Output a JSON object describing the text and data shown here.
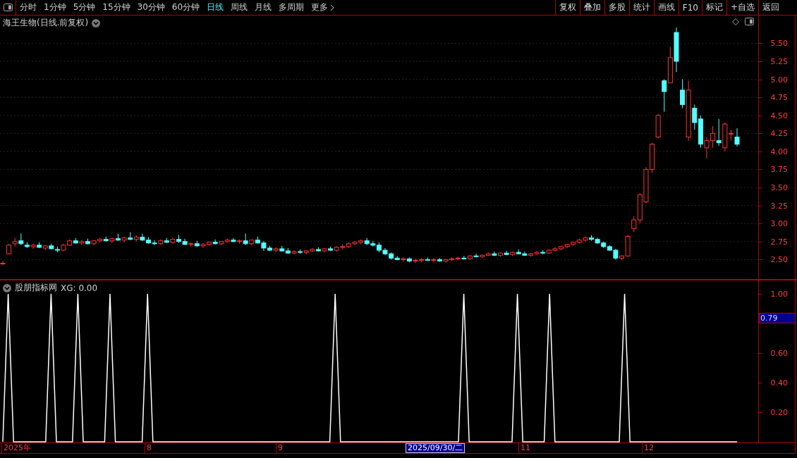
{
  "toolbar": {
    "periods": [
      {
        "label": "分时",
        "selected": false
      },
      {
        "label": "1分钟",
        "selected": false
      },
      {
        "label": "5分钟",
        "selected": false
      },
      {
        "label": "15分钟",
        "selected": false
      },
      {
        "label": "30分钟",
        "selected": false
      },
      {
        "label": "60分钟",
        "selected": false
      },
      {
        "label": "日线",
        "selected": true
      },
      {
        "label": "周线",
        "selected": false
      },
      {
        "label": "月线",
        "selected": false
      },
      {
        "label": "多周期",
        "selected": false
      },
      {
        "label": "更多",
        "selected": false
      }
    ],
    "actions": [
      "复权",
      "叠加",
      "多股",
      "统计",
      "画线",
      "F10",
      "标记",
      "+自选",
      "返回"
    ]
  },
  "price_panel": {
    "title": "海王生物(日线.前复权)",
    "chart_data": {
      "type": "candlestick",
      "grid": true,
      "ylim": [
        2.23,
        6.1
      ],
      "yticks": [
        {
          "value": 5.5,
          "label": "5.50"
        },
        {
          "value": 5.25,
          "label": "5.25"
        },
        {
          "value": 5,
          "label": "5.00"
        },
        {
          "value": 4.75,
          "label": "4.75"
        },
        {
          "value": 4.5,
          "label": "4.50"
        },
        {
          "value": 4.25,
          "label": "4.25"
        },
        {
          "value": 4,
          "label": "4.00"
        },
        {
          "value": 3.75,
          "label": "3.75"
        },
        {
          "value": 3.5,
          "label": "3.50"
        },
        {
          "value": 3.25,
          "label": "3.25"
        },
        {
          "value": 3,
          "label": "3.00"
        },
        {
          "value": 2.75,
          "label": "2.75"
        },
        {
          "value": 2.5,
          "label": "2.50"
        }
      ],
      "ohlc": [
        [
          2.44,
          2.48,
          2.42,
          2.45
        ],
        [
          2.58,
          2.72,
          2.57,
          2.7
        ],
        [
          2.72,
          2.8,
          2.68,
          2.75
        ],
        [
          2.76,
          2.86,
          2.7,
          2.72
        ],
        [
          2.7,
          2.74,
          2.66,
          2.68
        ],
        [
          2.68,
          2.72,
          2.65,
          2.7
        ],
        [
          2.7,
          2.74,
          2.66,
          2.67
        ],
        [
          2.66,
          2.7,
          2.63,
          2.69
        ],
        [
          2.69,
          2.72,
          2.64,
          2.65
        ],
        [
          2.64,
          2.68,
          2.6,
          2.63
        ],
        [
          2.63,
          2.72,
          2.62,
          2.7
        ],
        [
          2.7,
          2.78,
          2.69,
          2.76
        ],
        [
          2.76,
          2.8,
          2.72,
          2.73
        ],
        [
          2.73,
          2.77,
          2.7,
          2.75
        ],
        [
          2.75,
          2.79,
          2.71,
          2.72
        ],
        [
          2.72,
          2.77,
          2.7,
          2.76
        ],
        [
          2.76,
          2.8,
          2.74,
          2.78
        ],
        [
          2.78,
          2.82,
          2.75,
          2.76
        ],
        [
          2.76,
          2.8,
          2.73,
          2.79
        ],
        [
          2.79,
          2.86,
          2.76,
          2.77
        ],
        [
          2.77,
          2.82,
          2.74,
          2.8
        ],
        [
          2.8,
          2.88,
          2.77,
          2.78
        ],
        [
          2.78,
          2.84,
          2.75,
          2.81
        ],
        [
          2.81,
          2.86,
          2.76,
          2.77
        ],
        [
          2.77,
          2.81,
          2.72,
          2.73
        ],
        [
          2.73,
          2.77,
          2.7,
          2.72
        ],
        [
          2.72,
          2.78,
          2.7,
          2.76
        ],
        [
          2.76,
          2.8,
          2.73,
          2.74
        ],
        [
          2.74,
          2.8,
          2.72,
          2.78
        ],
        [
          2.78,
          2.84,
          2.73,
          2.75
        ],
        [
          2.75,
          2.79,
          2.7,
          2.71
        ],
        [
          2.71,
          2.74,
          2.68,
          2.72
        ],
        [
          2.72,
          2.76,
          2.68,
          2.69
        ],
        [
          2.69,
          2.73,
          2.66,
          2.71
        ],
        [
          2.71,
          2.75,
          2.69,
          2.74
        ],
        [
          2.74,
          2.78,
          2.71,
          2.72
        ],
        [
          2.72,
          2.76,
          2.7,
          2.75
        ],
        [
          2.75,
          2.79,
          2.73,
          2.77
        ],
        [
          2.77,
          2.8,
          2.74,
          2.75
        ],
        [
          2.75,
          2.78,
          2.72,
          2.76
        ],
        [
          2.76,
          2.86,
          2.7,
          2.72
        ],
        [
          2.72,
          2.78,
          2.7,
          2.77
        ],
        [
          2.77,
          2.82,
          2.72,
          2.73
        ],
        [
          2.73,
          2.76,
          2.62,
          2.66
        ],
        [
          2.66,
          2.69,
          2.62,
          2.63
        ],
        [
          2.63,
          2.67,
          2.6,
          2.65
        ],
        [
          2.65,
          2.69,
          2.61,
          2.62
        ],
        [
          2.62,
          2.66,
          2.58,
          2.59
        ],
        [
          2.59,
          2.63,
          2.57,
          2.61
        ],
        [
          2.61,
          2.64,
          2.58,
          2.6
        ],
        [
          2.6,
          2.63,
          2.57,
          2.62
        ],
        [
          2.62,
          2.66,
          2.6,
          2.64
        ],
        [
          2.64,
          2.67,
          2.61,
          2.62
        ],
        [
          2.62,
          2.66,
          2.6,
          2.65
        ],
        [
          2.65,
          2.68,
          2.62,
          2.63
        ],
        [
          2.63,
          2.69,
          2.61,
          2.67
        ],
        [
          2.67,
          2.71,
          2.64,
          2.68
        ],
        [
          2.68,
          2.74,
          2.66,
          2.72
        ],
        [
          2.72,
          2.76,
          2.7,
          2.74
        ],
        [
          2.74,
          2.78,
          2.71,
          2.76
        ],
        [
          2.76,
          2.8,
          2.7,
          2.72
        ],
        [
          2.72,
          2.76,
          2.68,
          2.7
        ],
        [
          2.7,
          2.74,
          2.6,
          2.63
        ],
        [
          2.63,
          2.66,
          2.56,
          2.58
        ],
        [
          2.58,
          2.6,
          2.5,
          2.52
        ],
        [
          2.52,
          2.55,
          2.49,
          2.5
        ],
        [
          2.5,
          2.53,
          2.47,
          2.51
        ],
        [
          2.51,
          2.53,
          2.46,
          2.48
        ],
        [
          2.48,
          2.51,
          2.45,
          2.49
        ],
        [
          2.49,
          2.52,
          2.46,
          2.5
        ],
        [
          2.5,
          2.53,
          2.48,
          2.49
        ],
        [
          2.49,
          2.52,
          2.46,
          2.5
        ],
        [
          2.5,
          2.52,
          2.47,
          2.48
        ],
        [
          2.48,
          2.51,
          2.46,
          2.5
        ],
        [
          2.5,
          2.53,
          2.48,
          2.51
        ],
        [
          2.51,
          2.54,
          2.49,
          2.52
        ],
        [
          2.52,
          2.55,
          2.5,
          2.51
        ],
        [
          2.51,
          2.56,
          2.5,
          2.55
        ],
        [
          2.55,
          2.58,
          2.53,
          2.54
        ],
        [
          2.54,
          2.57,
          2.52,
          2.56
        ],
        [
          2.56,
          2.6,
          2.55,
          2.58
        ],
        [
          2.58,
          2.61,
          2.55,
          2.56
        ],
        [
          2.56,
          2.6,
          2.54,
          2.59
        ],
        [
          2.59,
          2.62,
          2.56,
          2.57
        ],
        [
          2.57,
          2.61,
          2.55,
          2.6
        ],
        [
          2.6,
          2.64,
          2.58,
          2.58
        ],
        [
          2.58,
          2.61,
          2.55,
          2.56
        ],
        [
          2.56,
          2.59,
          2.54,
          2.58
        ],
        [
          2.58,
          2.62,
          2.56,
          2.6
        ],
        [
          2.6,
          2.63,
          2.57,
          2.59
        ],
        [
          2.59,
          2.64,
          2.58,
          2.63
        ],
        [
          2.63,
          2.67,
          2.61,
          2.65
        ],
        [
          2.65,
          2.69,
          2.63,
          2.68
        ],
        [
          2.68,
          2.72,
          2.66,
          2.71
        ],
        [
          2.71,
          2.75,
          2.69,
          2.74
        ],
        [
          2.74,
          2.79,
          2.72,
          2.77
        ],
        [
          2.77,
          2.82,
          2.75,
          2.8
        ],
        [
          2.8,
          2.84,
          2.76,
          2.78
        ],
        [
          2.78,
          2.8,
          2.72,
          2.73
        ],
        [
          2.73,
          2.75,
          2.66,
          2.68
        ],
        [
          2.68,
          2.7,
          2.62,
          2.63
        ],
        [
          2.63,
          2.65,
          2.5,
          2.52
        ],
        [
          2.52,
          2.56,
          2.49,
          2.55
        ],
        [
          2.55,
          2.85,
          2.54,
          2.82
        ],
        [
          2.93,
          3.1,
          2.88,
          3.05
        ],
        [
          3.05,
          3.42,
          3.0,
          3.4
        ],
        [
          3.3,
          3.78,
          3.28,
          3.75
        ],
        [
          3.75,
          4.12,
          3.7,
          4.1
        ],
        [
          4.2,
          4.52,
          4.18,
          4.5
        ],
        [
          4.98,
          5.0,
          4.55,
          4.83
        ],
        [
          4.95,
          5.45,
          4.95,
          5.3
        ],
        [
          5.65,
          5.72,
          5.1,
          5.25
        ],
        [
          4.85,
          5.0,
          4.6,
          4.65
        ],
        [
          4.2,
          4.98,
          4.15,
          4.85
        ],
        [
          4.6,
          4.65,
          4.3,
          4.4
        ],
        [
          4.45,
          4.5,
          4.05,
          4.1
        ],
        [
          4.05,
          4.2,
          3.9,
          4.15
        ],
        [
          4.15,
          4.35,
          4.05,
          4.25
        ],
        [
          4.15,
          4.45,
          4.08,
          4.12
        ],
        [
          4.05,
          4.4,
          4.0,
          4.38
        ],
        [
          4.25,
          4.3,
          4.15,
          4.25
        ],
        [
          4.2,
          4.32,
          4.07,
          4.1
        ]
      ]
    }
  },
  "indicator_panel": {
    "title": "股朋指标网",
    "reading": "XG: 0.00",
    "cursor_value": "0.79",
    "chart_data": {
      "type": "line",
      "ylim": [
        0,
        1.09
      ],
      "categories": [
        null,
        null,
        null,
        null,
        null,
        null,
        null,
        null,
        null,
        null,
        null,
        null,
        null,
        null,
        null,
        null,
        null,
        null,
        null,
        null,
        null,
        null,
        null,
        null,
        null,
        null,
        null,
        null,
        null,
        null,
        null,
        null,
        null,
        null,
        null,
        null,
        null,
        null,
        null,
        null,
        null,
        null,
        null,
        null,
        null,
        null,
        null,
        null,
        null,
        null,
        null,
        null,
        null,
        null,
        null,
        null,
        null,
        null,
        null,
        null,
        null,
        null,
        null,
        null,
        null,
        null,
        null,
        null,
        null,
        null,
        null,
        null,
        null,
        null,
        null,
        null,
        null,
        null,
        null,
        null,
        null,
        null,
        null,
        null,
        null,
        null,
        null,
        null,
        null,
        null,
        null,
        null,
        null,
        null,
        null,
        null,
        null,
        null,
        null,
        null,
        null,
        null,
        null,
        null,
        null,
        null,
        null,
        null,
        null,
        null,
        null,
        null,
        null,
        null,
        null,
        null,
        null,
        null,
        null,
        null,
        null,
        null,
        null,
        null,
        null,
        null,
        null,
        null,
        null,
        null,
        null,
        null,
        null,
        null,
        null,
        null,
        null,
        null
      ],
      "yticks": [
        {
          "value": 1,
          "label": "1.00"
        },
        {
          "value": 0.6,
          "label": "0.60"
        },
        {
          "value": 0.4,
          "label": "0.40"
        },
        {
          "value": 0.2,
          "label": "0.20"
        }
      ],
      "series": [
        {
          "color": "#ffffff",
          "values": [
            0,
            1,
            0,
            0,
            0,
            0,
            0,
            0,
            0,
            1,
            0,
            0,
            0,
            0,
            1,
            0,
            0,
            0,
            0,
            0,
            1,
            0,
            0,
            0,
            0,
            0,
            0,
            1,
            0,
            0,
            0,
            0,
            0,
            0,
            0,
            0,
            0,
            0,
            0,
            0,
            0,
            0,
            0,
            0,
            0,
            0,
            0,
            0,
            0,
            0,
            0,
            0,
            0,
            0,
            0,
            0,
            0,
            0,
            0,
            0,
            0,
            0,
            1,
            0,
            0,
            0,
            0,
            0,
            0,
            0,
            0,
            0,
            0,
            0,
            0,
            0,
            0,
            0,
            0,
            0,
            0,
            0,
            0,
            0,
            0,
            0,
            1,
            0,
            0,
            0,
            0,
            0,
            0,
            0,
            0,
            0,
            1,
            0,
            0,
            0,
            0,
            0,
            1,
            0,
            0,
            0,
            0,
            0,
            0,
            0,
            0,
            0,
            0,
            0,
            0,
            0,
            1,
            0,
            0,
            0,
            0,
            0,
            0,
            0,
            0,
            0,
            0,
            0,
            0,
            0,
            0,
            0,
            0,
            0,
            0,
            0,
            0,
            0
          ]
        }
      ]
    }
  },
  "date_axis": [
    {
      "label": "2025年",
      "selected": false
    },
    {
      "label": "8",
      "selected": false
    },
    {
      "label": "9",
      "selected": false
    },
    {
      "label": "2025/09/30/二",
      "selected": true
    },
    {
      "label": "11",
      "selected": false
    },
    {
      "label": "12",
      "selected": false
    }
  ]
}
